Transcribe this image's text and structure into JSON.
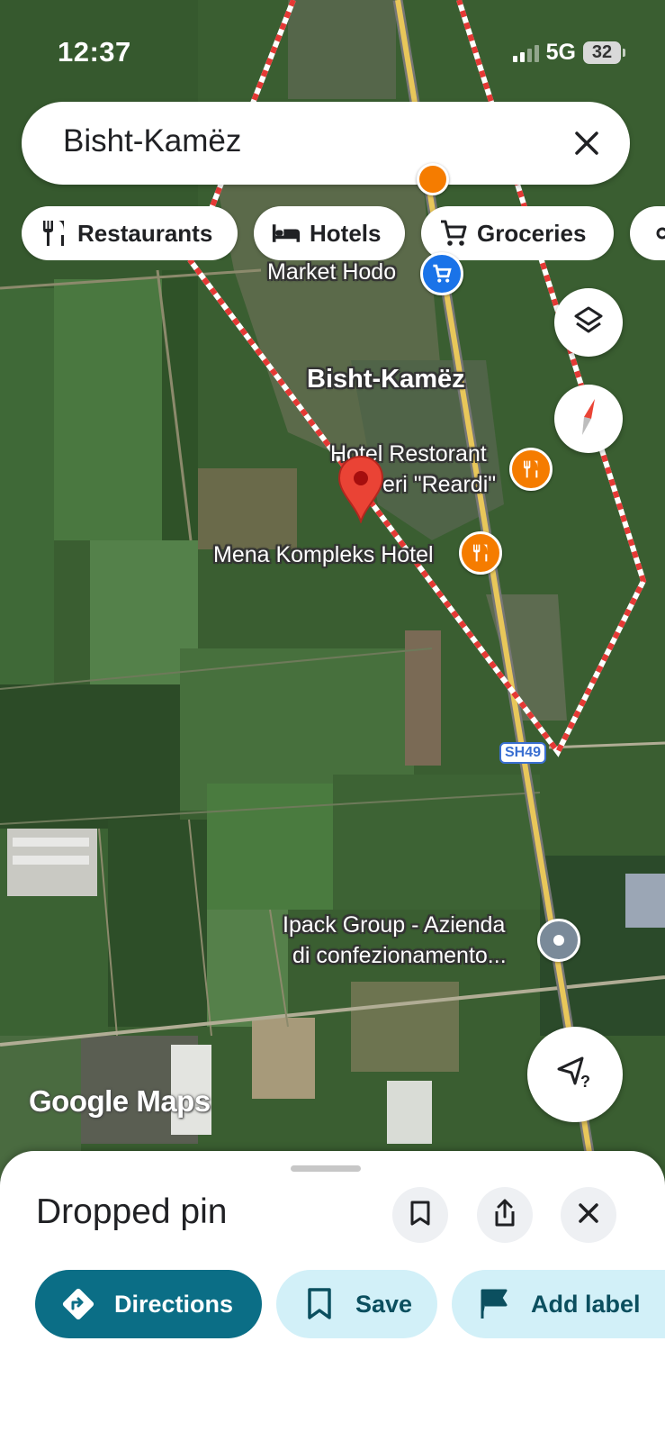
{
  "status_bar": {
    "time": "12:37",
    "network": "5G",
    "battery": "32"
  },
  "search": {
    "query": "Bisht-Kamëz"
  },
  "chips": [
    {
      "label": "Restaurants",
      "icon": "fork-knife-icon"
    },
    {
      "label": "Hotels",
      "icon": "bed-icon"
    },
    {
      "label": "Groceries",
      "icon": "cart-icon"
    }
  ],
  "map": {
    "place_labels": {
      "area": "Bisht-Kamëz",
      "market": "Market Hodo",
      "hotel_restorant_line1": "Hotel Restorant",
      "hotel_restorant_line2": "eri \"Reardi\"",
      "mena": "Mena Kompleks Hotel",
      "ipack_line1": "Ipack Group - Azienda",
      "ipack_line2": "di confezionamento..."
    },
    "road_shield": "SH49",
    "logo": "Google Maps",
    "colors": {
      "boundary": "#e53935",
      "road": "#e8c75a",
      "food_poi": "#f57c00",
      "shop_poi": "#1a73e8",
      "pin": "#ea4335"
    }
  },
  "sheet": {
    "title": "Dropped pin",
    "actions": {
      "directions": "Directions",
      "save": "Save",
      "add_label": "Add label"
    },
    "colors": {
      "primary": "#0b6e86",
      "tonal": "#d2f0f8",
      "tonal_text": "#0b4f5f"
    }
  }
}
